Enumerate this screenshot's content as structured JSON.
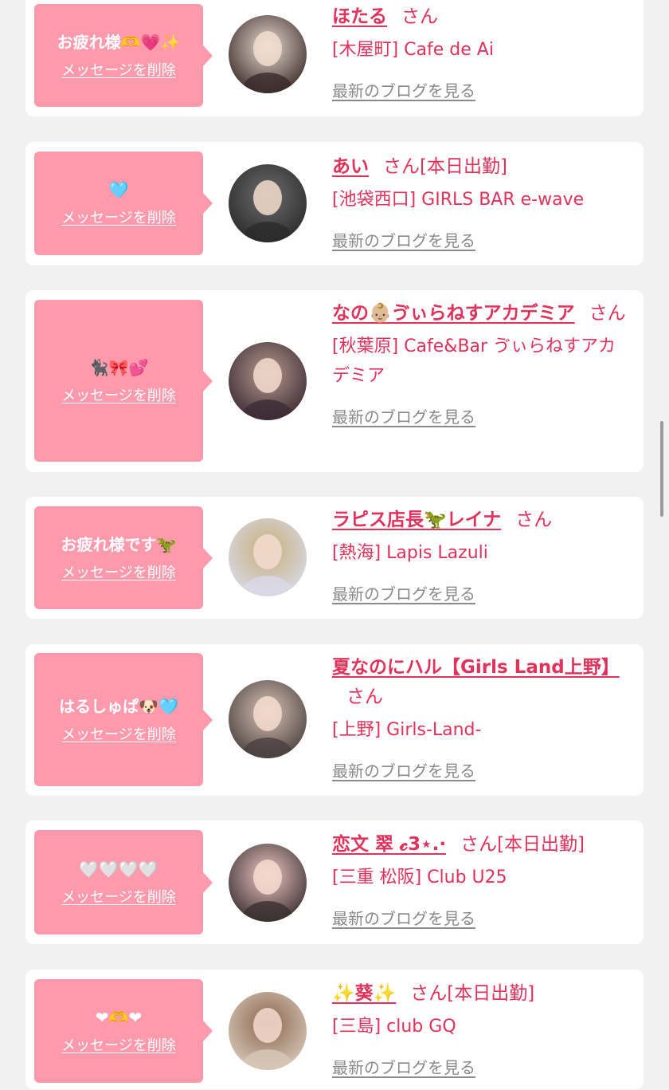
{
  "delete_label": "メッセージを削除",
  "blog_label": "最新のブログを見る",
  "colors": {
    "bubble": "#ff9aad",
    "accent": "#e0325a",
    "muted": "#8a8a8a",
    "background": "#f1f1f1"
  },
  "items": [
    {
      "message": "お疲れ様🫶💗✨",
      "name": "ほたる",
      "honorific": "さん",
      "today": "",
      "shop": "[木屋町] Cafe de Ai",
      "avatar_tone": [
        "#e9dcd0",
        "#3a2a2a"
      ]
    },
    {
      "message": "🩵",
      "name": "あい",
      "honorific": "さん",
      "today": "[本日出勤]",
      "shop": "[池袋西口] GIRLS BAR e-wave",
      "avatar_tone": [
        "#6d6d6d",
        "#2a2a2a"
      ]
    },
    {
      "message": "🐈‍⬛🎀💕",
      "name": "なの👶🏼ゔぃらねすアカデミア",
      "honorific": "さん",
      "today": "",
      "shop": "[秋葉原] Cafe&Bar ゔぃらねすアカデミア",
      "avatar_tone": [
        "#b89a8c",
        "#3b2b35"
      ]
    },
    {
      "message": "お疲れ様です🦖",
      "name": "ラピス店長🦖レイナ",
      "honorific": "さん",
      "today": "",
      "shop": "[熱海] Lapis Lazuli",
      "avatar_tone": [
        "#c7b07a",
        "#d9d9e8"
      ]
    },
    {
      "message": "はるしゅぱ🐶🩵",
      "name": "夏なのにハル【Girls Land上野】",
      "honorific": "さん",
      "today": "",
      "shop": "[上野] Girls-Land-",
      "avatar_tone": [
        "#d8c3b3",
        "#4a4040"
      ]
    },
    {
      "message": "🤍🤍🤍🤍",
      "name": "恋文 翠 𝓬3⋆.·",
      "honorific": "さん",
      "today": "[本日出勤]",
      "shop": "[三重 松阪] Club U25",
      "avatar_tone": [
        "#f1c6c6",
        "#3a3030"
      ]
    },
    {
      "message": "❤🫶❤",
      "name": "✨葵✨",
      "honorific": "さん",
      "today": "[本日出勤]",
      "shop": "[三島] club GQ",
      "avatar_tone": [
        "#8a6650",
        "#d8c8b8"
      ]
    }
  ]
}
